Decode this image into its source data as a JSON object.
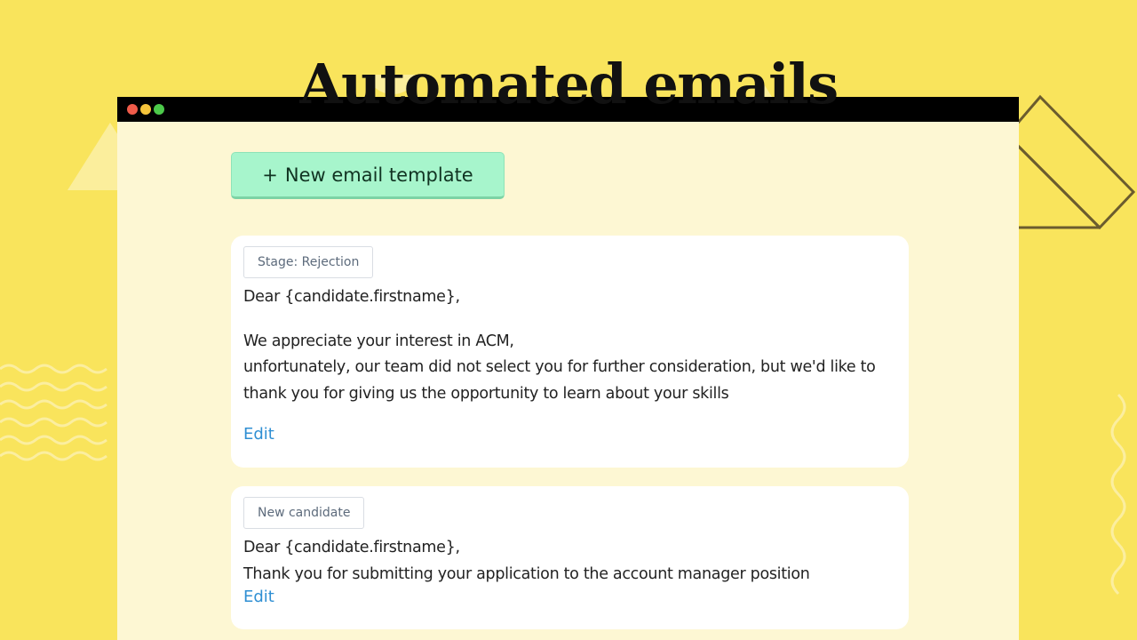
{
  "page": {
    "heading": "Automated emails",
    "accent_color": "#f9e45c"
  },
  "window": {
    "controls": [
      "close",
      "minimize",
      "maximize"
    ],
    "control_colors": [
      "#ef5b4a",
      "#f5c43b",
      "#4cc94a"
    ]
  },
  "new_template_button": {
    "icon": "+",
    "label": "New email template",
    "color": "#a7f5cc"
  },
  "templates": [
    {
      "stage": "Stage: Rejection",
      "greeting": "Dear {candidate.firstname},",
      "line1": "We appreciate your interest in ACM,",
      "line2": "unfortunately, our team did not select you for further consideration, but we'd like to",
      "line3": "thank you for giving us the opportunity to learn about your skills",
      "edit_label": "Edit"
    },
    {
      "stage": "New candidate",
      "greeting": "Dear {candidate.firstname},",
      "line1": "Thank you for submitting your application to the account manager position",
      "edit_label": "Edit"
    }
  ],
  "link_color": "#2f8fd3"
}
